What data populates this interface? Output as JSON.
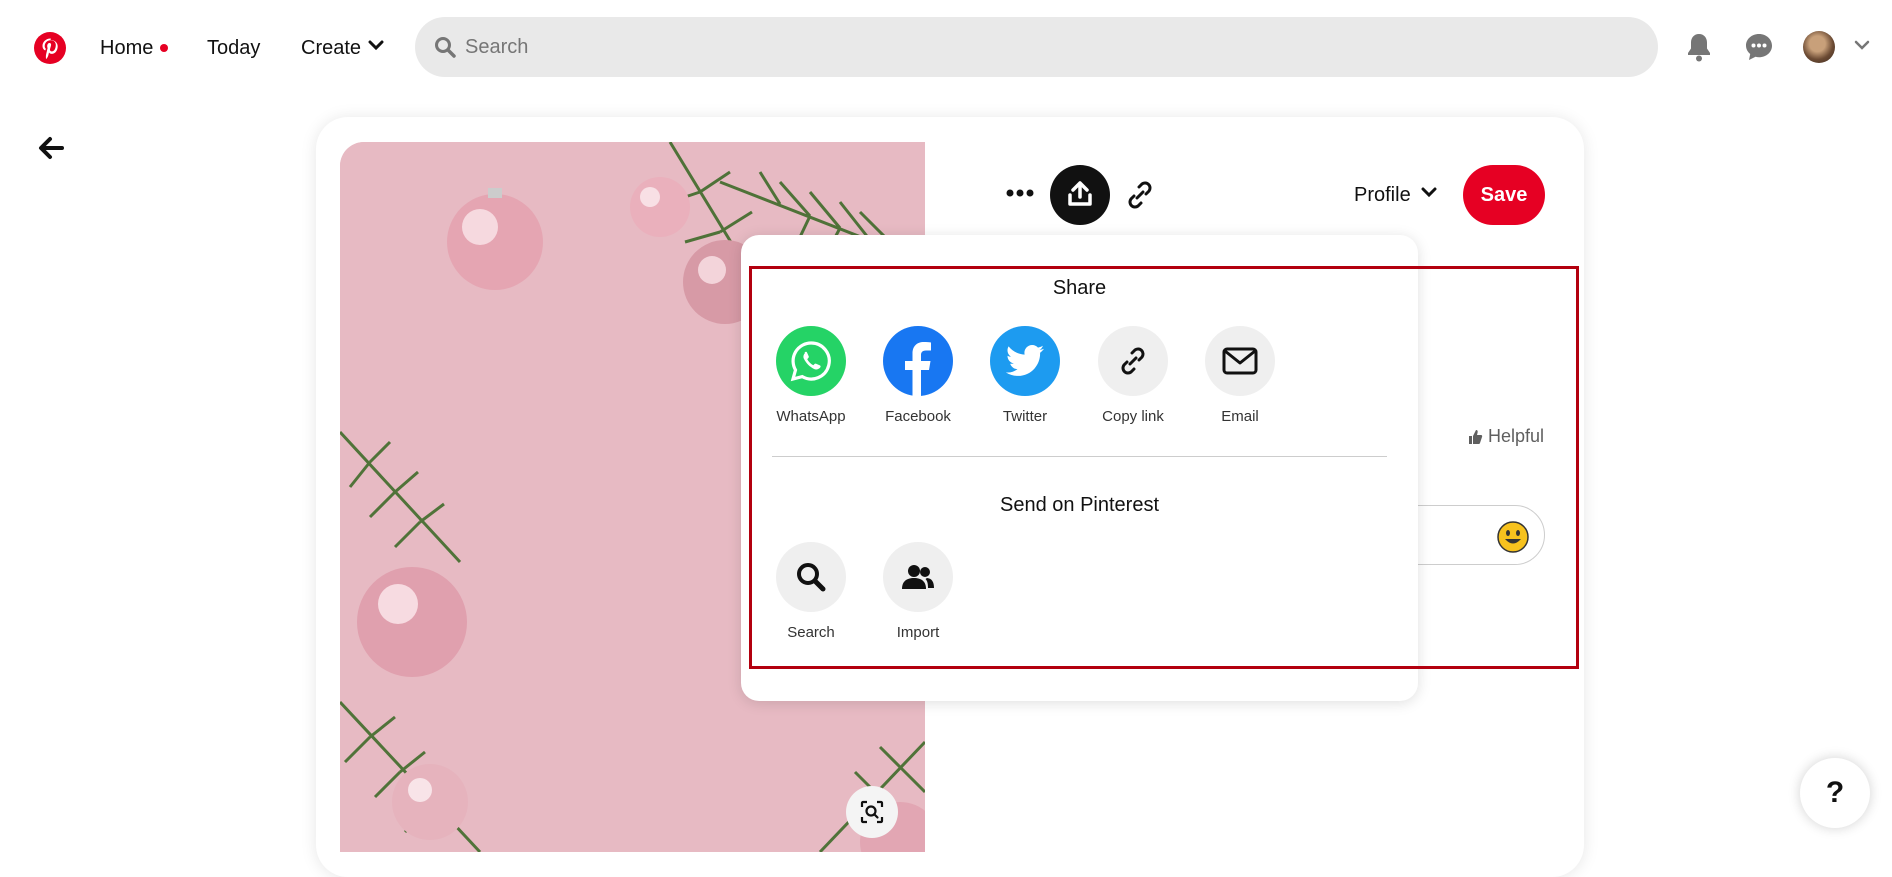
{
  "nav": {
    "home": "Home",
    "today": "Today",
    "create": "Create",
    "search_placeholder": "Search"
  },
  "pin": {
    "profile_label": "Profile",
    "save_label": "Save",
    "helpful_label": "Helpful"
  },
  "share_menu": {
    "title": "Share",
    "items": [
      {
        "label": "WhatsApp",
        "icon": "whatsapp-icon",
        "color": "#25d366"
      },
      {
        "label": "Facebook",
        "icon": "facebook-icon",
        "color": "#1877f2"
      },
      {
        "label": "Twitter",
        "icon": "twitter-icon",
        "color": "#1d9bf0"
      },
      {
        "label": "Copy link",
        "icon": "link-icon",
        "color": "#efefef"
      },
      {
        "label": "Email",
        "icon": "email-icon",
        "color": "#efefef"
      }
    ],
    "send_title": "Send on Pinterest",
    "send_items": [
      {
        "label": "Search",
        "icon": "search-icon"
      },
      {
        "label": "Import",
        "icon": "contacts-icon"
      }
    ]
  },
  "help_label": "?",
  "colors": {
    "brand": "#e60023",
    "highlight": "#b3000f"
  }
}
